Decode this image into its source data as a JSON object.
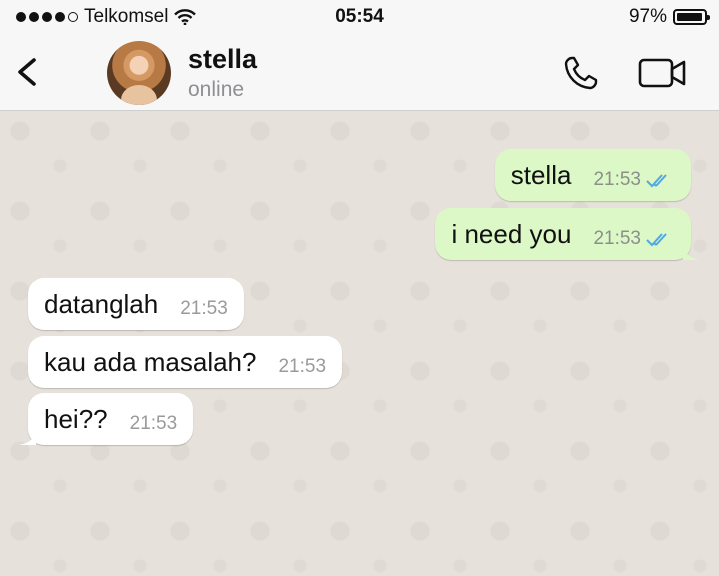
{
  "status_bar": {
    "carrier": "Telkomsel",
    "time": "05:54",
    "battery_percent": "97%",
    "battery_level": 0.97
  },
  "header": {
    "contact_name": "stella",
    "contact_status": "online"
  },
  "messages": [
    {
      "direction": "out",
      "text": "stella",
      "time": "21:53",
      "status": "read"
    },
    {
      "direction": "out",
      "text": "i need you",
      "time": "21:53",
      "status": "read"
    },
    {
      "direction": "in",
      "text": "datanglah",
      "time": "21:53"
    },
    {
      "direction": "in",
      "text": "kau ada masalah?",
      "time": "21:53"
    },
    {
      "direction": "in",
      "text": "hei??",
      "time": "21:53"
    }
  ],
  "colors": {
    "outgoing_bubble": "#dcf8c6",
    "incoming_bubble": "#ffffff",
    "chat_background": "#e6e1da",
    "read_ticks": "#4fa7e6"
  }
}
